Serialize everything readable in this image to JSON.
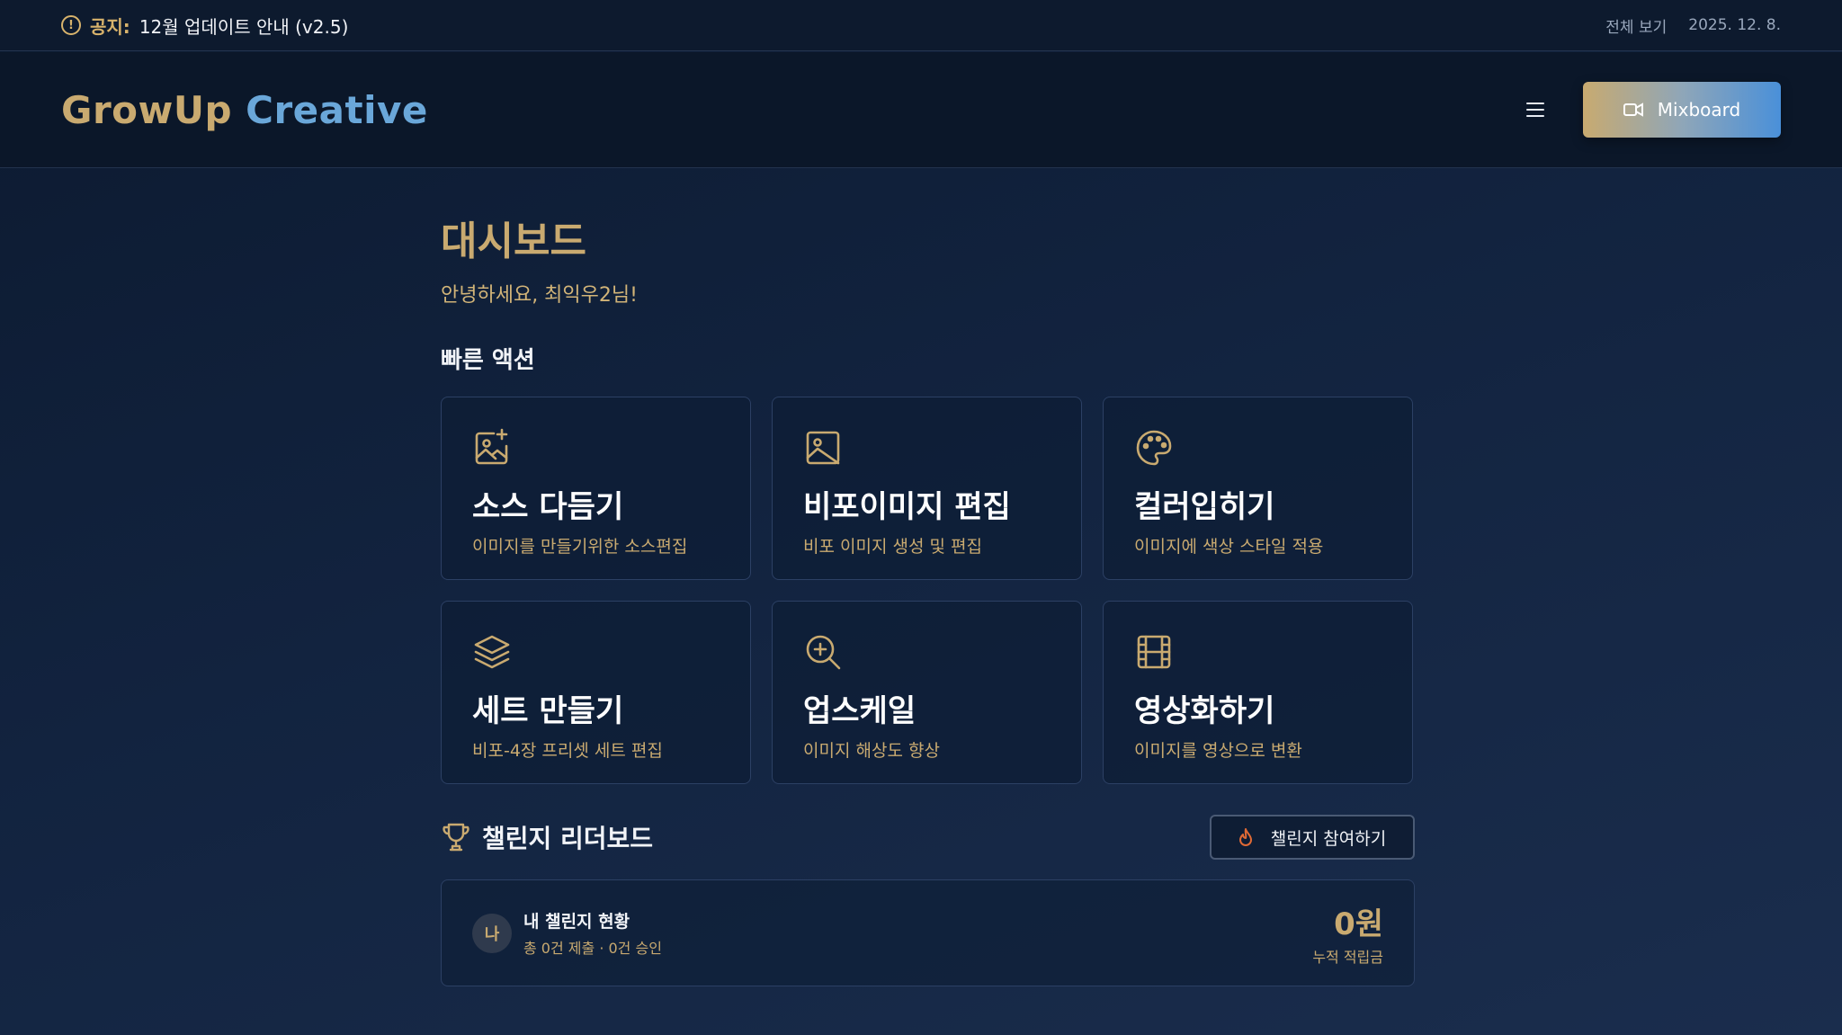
{
  "notice": {
    "prefix": "공지:",
    "text": "12월 업데이트 안내 (v2.5)",
    "view_all": "전체 보기",
    "date": "2025. 12. 8."
  },
  "header": {
    "brand_part1": "GrowUp",
    "brand_part2": "Creative",
    "mixboard_label": "Mixboard"
  },
  "main": {
    "title": "대시보드",
    "greeting": "안녕하세요, 최익우2님!",
    "quick_actions_title": "빠른 액션",
    "actions": [
      {
        "icon": "image-plus-icon",
        "title": "소스 다듬기",
        "desc": "이미지를 만들기위한 소스편집"
      },
      {
        "icon": "image-icon",
        "title": "비포이미지 편집",
        "desc": "비포 이미지 생성 및 편집"
      },
      {
        "icon": "palette-icon",
        "title": "컬러입히기",
        "desc": "이미지에 색상 스타일 적용"
      },
      {
        "icon": "layers-icon",
        "title": "세트 만들기",
        "desc": "비포-4장 프리셋 세트 편집"
      },
      {
        "icon": "zoom-in-icon",
        "title": "업스케일",
        "desc": "이미지 해상도 향상"
      },
      {
        "icon": "film-icon",
        "title": "영상화하기",
        "desc": "이미지를 영상으로 변환"
      }
    ],
    "leaderboard_title": "챌린지 리더보드",
    "join_label": "챌린지 참여하기",
    "status": {
      "avatar": "나",
      "title": "내 챌린지 현황",
      "sub": "총 0건 제출 · 0건 승인",
      "points": "0원",
      "points_label": "누적 적립금"
    }
  },
  "colors": {
    "accent_gold": "#c9aa70",
    "accent_blue": "#6aa7d9",
    "background": "#12233f"
  }
}
